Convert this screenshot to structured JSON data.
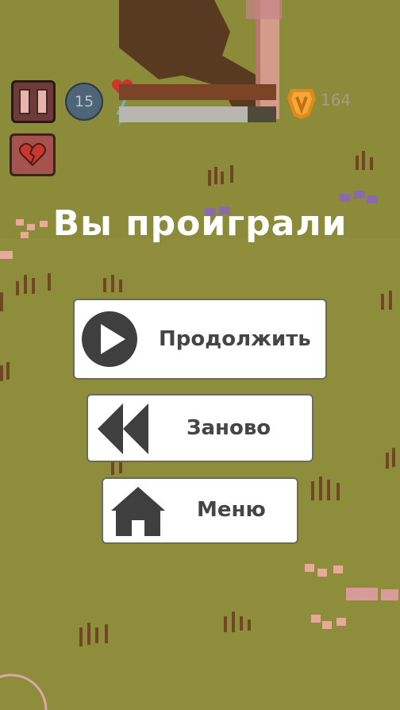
{
  "hud": {
    "pause_icon": "pause-icon",
    "heart_button_icon": "broken-heart-icon",
    "level": "15",
    "hp_icon": "heart-icon",
    "hp_fraction": 1.0,
    "energy_icon": "lightning-icon",
    "energy_fraction": 0.82,
    "coin_icon": "coin-icon",
    "coins": "164"
  },
  "dialog": {
    "title": "Вы проиграли",
    "buttons": [
      {
        "label": "Продолжить",
        "icon": "play-icon"
      },
      {
        "label": "Заново",
        "icon": "rewind-icon"
      },
      {
        "label": "Меню",
        "icon": "home-icon"
      }
    ]
  },
  "colors": {
    "ground": "#8c8c3a",
    "title_text": "#ffffff",
    "button_bg": "#ffffff",
    "button_icon": "#3f3f3f"
  }
}
